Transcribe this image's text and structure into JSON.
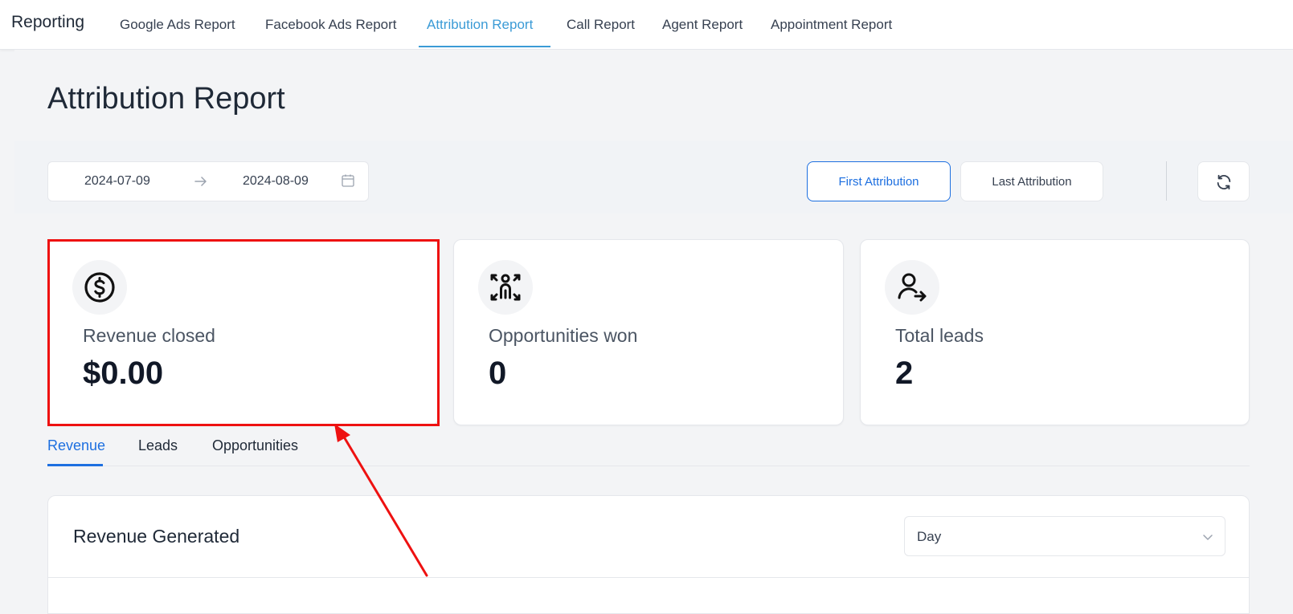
{
  "nav": {
    "brand": "Reporting",
    "tabs": [
      {
        "label": "Google Ads Report"
      },
      {
        "label": "Facebook Ads Report"
      },
      {
        "label": "Attribution Report"
      },
      {
        "label": "Call Report"
      },
      {
        "label": "Agent Report"
      },
      {
        "label": "Appointment Report"
      }
    ],
    "active_tab": "Attribution Report"
  },
  "page": {
    "title": "Attribution Report"
  },
  "filters": {
    "date_start": "2024-07-09",
    "date_end": "2024-08-09",
    "first_attribution": "First Attribution",
    "last_attribution": "Last Attribution",
    "selected_attribution": "First Attribution"
  },
  "stats": [
    {
      "label": "Revenue closed",
      "value": "$0.00",
      "icon": "dollar-circle-icon"
    },
    {
      "label": "Opportunities won",
      "value": "0",
      "icon": "person-arrows-icon"
    },
    {
      "label": "Total leads",
      "value": "2",
      "icon": "user-arrow-icon"
    }
  ],
  "subtabs": [
    {
      "label": "Revenue"
    },
    {
      "label": "Leads"
    },
    {
      "label": "Opportunities"
    }
  ],
  "active_subtab": "Revenue",
  "revenue": {
    "title": "Revenue Generated",
    "granularity": "Day"
  },
  "colors": {
    "nav_active": "#3b9bd6",
    "primary": "#1d6fe0",
    "annotation": "#ee1111"
  }
}
